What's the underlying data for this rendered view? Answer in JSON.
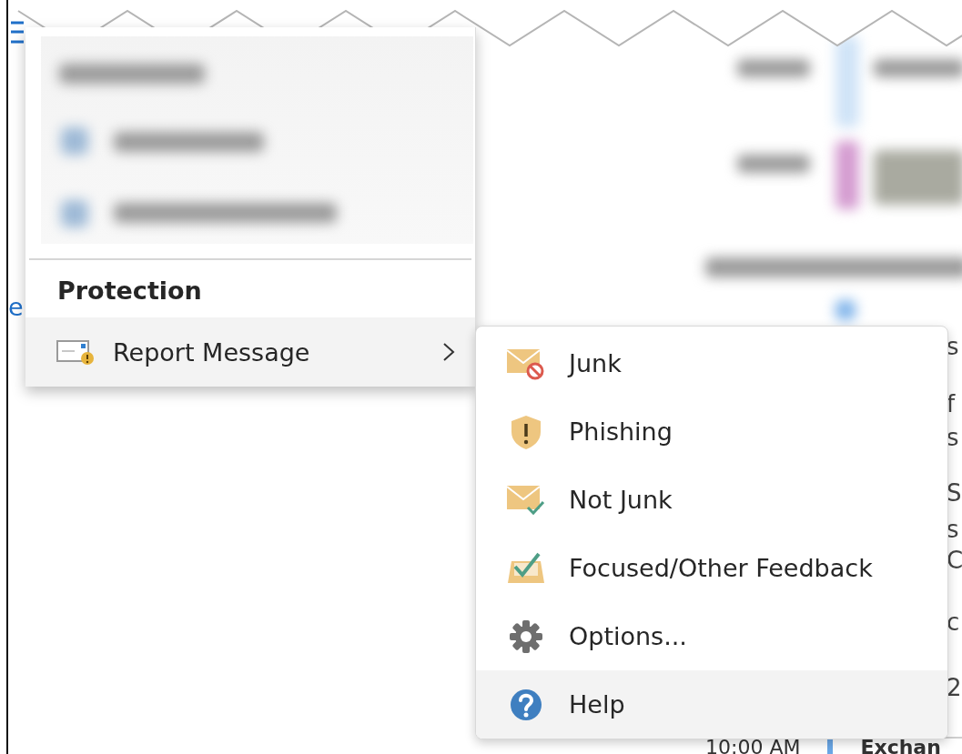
{
  "background": {
    "left_link_fragment": "e",
    "list_fragments": [
      "s",
      "f",
      "s",
      "S",
      "s",
      "C",
      "c",
      "2"
    ],
    "bottom_row": {
      "time": "10:00 AM",
      "sender": "Exchan"
    }
  },
  "menu": {
    "section_header": "Protection",
    "items": [
      {
        "label": "Report Message",
        "kind": "report",
        "selected": true,
        "has_submenu": true
      }
    ]
  },
  "submenu": {
    "items": [
      {
        "label": "Junk",
        "kind": "junk",
        "selected": false
      },
      {
        "label": "Phishing",
        "kind": "phishing",
        "selected": false
      },
      {
        "label": "Not Junk",
        "kind": "notjunk",
        "selected": false
      },
      {
        "label": "Focused/Other Feedback",
        "kind": "focused",
        "selected": false
      },
      {
        "label": "Options...",
        "kind": "options",
        "selected": false
      },
      {
        "label": "Help",
        "kind": "help",
        "selected": true
      }
    ]
  }
}
